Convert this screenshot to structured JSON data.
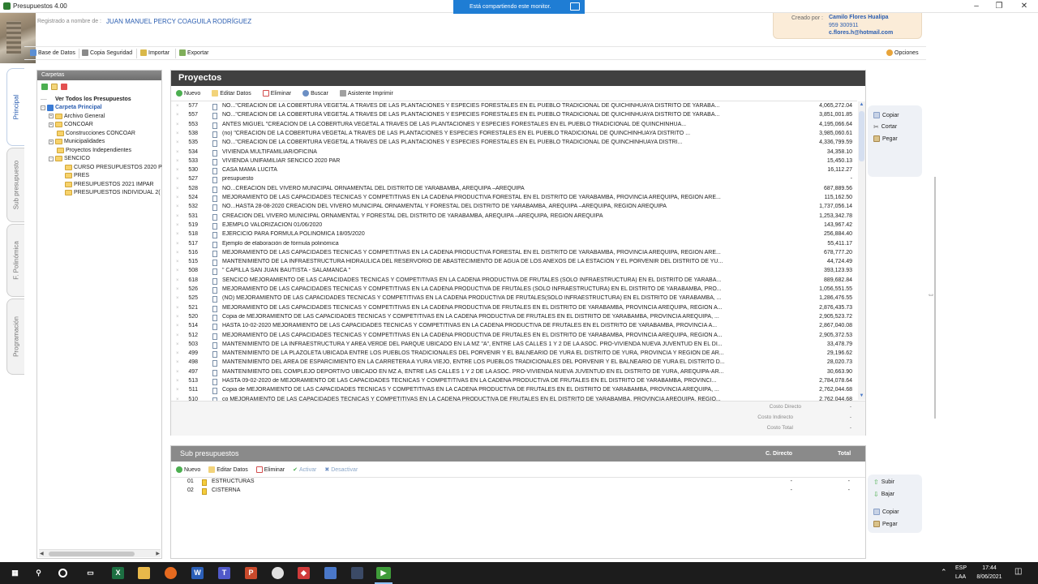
{
  "window": {
    "title": "Presupuestos 4.00",
    "share_banner": "Está compartiendo este monitor."
  },
  "header": {
    "registered_label": "Registrado a nombre de :",
    "registered_name": "JUAN MANUEL PERCY COAGUILA RODRÍGUEZ",
    "creator_label": "Creado por :",
    "creator_name": "Camilo Flores Hualipa",
    "creator_phone": "959 300911",
    "creator_email": "c.flores.h@hotmail.com"
  },
  "toolbar": {
    "database": "Base de Datos",
    "backup": "Copia Seguridad",
    "import": "Importar",
    "export": "Exportar",
    "options": "Opciones"
  },
  "vertical_tabs": [
    "Principal",
    "Sub presupuesto",
    "F. Polinómica",
    "Programación"
  ],
  "folders": {
    "title": "Carpetas",
    "items": [
      {
        "label": "Ver Todos los Presupuestos",
        "bold": true
      },
      {
        "label": "Carpeta Principal"
      },
      {
        "label": "Archivo General"
      },
      {
        "label": "CONCOAR"
      },
      {
        "label": "Construcciones CONCOAR"
      },
      {
        "label": "Municipalidades"
      },
      {
        "label": "Proyectos Independientes"
      },
      {
        "label": "SENCICO"
      },
      {
        "label": "CURSO PRESUPUESTOS 2020 P"
      },
      {
        "label": "PRES"
      },
      {
        "label": "PRESUPUESTOS 2021 IMPAR"
      },
      {
        "label": "PRESUPUESTOS INDIVIDUAL 2("
      }
    ]
  },
  "projects": {
    "title": "Proyectos",
    "tools": {
      "new": "Nuevo",
      "edit": "Editar Datos",
      "delete": "Eliminar",
      "search": "Buscar",
      "print": "Asistente Imprimir"
    },
    "rows": [
      {
        "id": "577",
        "desc": "NO...\"CREACION DE LA COBERTURA VEGETAL A TRAVES DE LAS PLANTACIONES Y ESPECIES FORESTALES  EN EL PUEBLO TRADICIONAL DE QUICHINHUAYA DISTRITO DE YARABA...",
        "amount": "4,065,272.04"
      },
      {
        "id": "557",
        "desc": "NO...\"CREACION DE LA COBERTURA VEGETAL A TRAVES DE LAS PLANTACIONES Y ESPECIES FORESTALES  EN EL PUEBLO TRADICIONAL DE QUICHINHUAYA DISTRITO DE YARABA...",
        "amount": "3,851,001.85"
      },
      {
        "id": "553",
        "desc": "ANTES MIGUEL \"CREACION DE LA COBERTURA VEGETAL A TRAVES DE LAS PLANTACIONES Y ESPECIES FORESTALES EN EL PUEBLO TRADICIONAL DE QUINCHINHUA...",
        "amount": "4,195,066.64"
      },
      {
        "id": "538",
        "desc": "(no) \"CREACION DE LA COBERTURA VEGETAL A TRAVES DE LAS PLANTACIONES Y ESPECIES FORESTALES EN EL PUEBLO TRADICIONAL DE QUINCHINHUAYA DISTRITO ...",
        "amount": "3,985,060.61"
      },
      {
        "id": "535",
        "desc": "NO...\"CREACION DE LA COBERTURA VEGETAL A TRAVES DE LAS PLANTACIONES Y ESPECIES FORESTALES EN EL PUEBLO TRADICIONAL DE QUINCHINHUAYA DISTRI...",
        "amount": "4,336,799.59"
      },
      {
        "id": "534",
        "desc": "VIVIENDA MULTIFAMILIAR/OFICINA",
        "amount": "34,358.10"
      },
      {
        "id": "533",
        "desc": "VIVIENDA UNIFAMILIAR SENCICO 2020 PAR",
        "amount": "15,450.13"
      },
      {
        "id": "530",
        "desc": "CASA MAMÁ LUCITA",
        "amount": "16,112.27"
      },
      {
        "id": "527",
        "desc": "presupuesto",
        "amount": "-"
      },
      {
        "id": "528",
        "desc": "NO...CREACION DEL VIVERO MUNICIPAL ORNAMENTAL DEL DISTRITO DE YARABAMBA, AREQUIPA –AREQUIPA",
        "amount": "687,889.56"
      },
      {
        "id": "524",
        "desc": "MEJORAMIENTO DE LAS CAPACIDADES TÉCNICAS Y COMPETITIVAS EN LA CADENA PRODUCTIVA FORESTAL EN EL DISTRITO DE YARABAMBA, PROVINCIA AREQUIPA, REGIÓN ARE...",
        "amount": "115,162.50"
      },
      {
        "id": "532",
        "desc": "NO...HASTA 28-08-2020 CREACION DEL VIVERO MUNICIPAL ORNAMENTAL Y FORESTAL DEL DISTRITO DE YARABAMBA, AREQUIPA –AREQUIPA, REGIÓN AREQUIPA",
        "amount": "1,737,056.14"
      },
      {
        "id": "531",
        "desc": "CREACION DEL VIVERO MUNICIPAL ORNAMENTAL Y FORESTAL DEL DISTRITO DE YARABAMBA, AREQUIPA –AREQUIPA, REGIÓN AREQUIPA",
        "amount": "1,253,342.78"
      },
      {
        "id": "519",
        "desc": "EJEMPLO VALORIZACIÓN  01/06/2020",
        "amount": "143,967.42"
      },
      {
        "id": "518",
        "desc": "EJERCICIO PARA FÓRMULA POLINÓMICA 18/05/2020",
        "amount": "256,884.40"
      },
      {
        "id": "517",
        "desc": "Ejemplo de elaboración de fórmula polinómica",
        "amount": "55,411.17"
      },
      {
        "id": "516",
        "desc": "MEJORAMIENTO DE LAS CAPACIDADES TÉCNICAS Y COMPETITIVAS EN LA CADENA PRODUCTIVA FORESTAL EN EL DISTRITO DE YARABAMBA, PROVINCIA AREQUIPA, REGIÓN ARE...",
        "amount": "678,777.20"
      },
      {
        "id": "515",
        "desc": "MANTENIMIENTO DE LA INFRAESTRUCTURA HIDRÁULICA DEL  RESERVORIO DE ABASTECIMIENTO DE AGUA DE LOS ANEXOS DE LA ESTACIÓN Y EL PORVENIR DEL DISTRITO DE YU...",
        "amount": "44,724.49"
      },
      {
        "id": "508",
        "desc": "\" CAPILLA SAN JUAN BAUTISTA -  SALAMANCA \"",
        "amount": "393,123.93"
      },
      {
        "id": "618",
        "desc": "SENCICO MEJORAMIENTO DE LAS CAPACIDADES TÉCNICAS Y COMPETITIVAS EN LA CADENA PRODUCTIVA DE FRUTALES (SOLO INFRAESTRUCTURA) EN EL DISTRITO DE YARABA...",
        "amount": "889,682.84"
      },
      {
        "id": "526",
        "desc": "MEJORAMIENTO DE LAS CAPACIDADES TÉCNICAS Y COMPETITIVAS EN LA CADENA PRODUCTIVA DE FRUTALES (SOLO INFRAESTRUCTURA) EN EL DISTRITO DE YARABAMBA, PRO...",
        "amount": "1,056,551.55"
      },
      {
        "id": "525",
        "desc": "(NO) MEJORAMIENTO DE LAS CAPACIDADES TÉCNICAS Y COMPETITIVAS EN LA CADENA PRODUCTIVA DE FRUTALES(SOLO INFRAESTRUCTURA) EN EL DISTRITO DE YARABAMBA, ...",
        "amount": "1,286,476.55"
      },
      {
        "id": "521",
        "desc": "MEJORAMIENTO DE LAS CAPACIDADES TÉCNICAS Y COMPETITIVAS EN LA CADENA PRODUCTIVA DE FRUTALES EN EL DISTRITO DE YARABAMBA, PROVINCIA AREQUIPA, REGIÓN A...",
        "amount": "2,876,435.73"
      },
      {
        "id": "520",
        "desc": "Copia de MEJORAMIENTO DE LAS CAPACIDADES TÉCNICAS Y COMPETITIVAS EN LA CADENA PRODUCTIVA DE FRUTALES EN EL DISTRITO DE YARABAMBA, PROVINCIA AREQUIPA, ...",
        "amount": "2,905,523.72"
      },
      {
        "id": "514",
        "desc": "HASTA 10-02-2020 MEJORAMIENTO DE LAS CAPACIDADES TÉCNICAS Y COMPETITIVAS EN LA CADENA PRODUCTIVA DE FRUTALES EN EL DISTRITO DE YARABAMBA, PROVINCIA A...",
        "amount": "2,867,040.08"
      },
      {
        "id": "512",
        "desc": "MEJORAMIENTO DE LAS CAPACIDADES TÉCNICAS Y COMPETITIVAS EN LA CADENA PRODUCTIVA DE FRUTALES EN EL DISTRITO DE YARABAMBA, PROVINCIA AREQUIPA, REGIÓN A...",
        "amount": "2,905,372.53"
      },
      {
        "id": "503",
        "desc": "MANTENIMIENTO DE LA INFRAESTRUCTURA Y AREA VERDE DEL PARQUE UBICADO EN LA MZ \"A\", ENTRE LAS CALLES 1 Y 2 DE LA ASOC. PRO-VIVIENDA NUEVA JUVENTUD EN EL DI...",
        "amount": "33,478.79"
      },
      {
        "id": "499",
        "desc": "MANTENIMIENTO DE LA PLAZOLETA UBICADA ENTRE LOS PUEBLOS TRADICIONALES DEL PORVENIR Y EL BALNEARIO DE YURA EL DISTRITO DE YURA, PROVINCIA Y REGION DE AR...",
        "amount": "29,196.62"
      },
      {
        "id": "498",
        "desc": "MANTENIMIENTO DEL AREA DE ESPARCIMIENTO EN LA CARRETERA A YURA VIEJO, ENTRE LOS PUEBLOS TRADICIONALES DEL PORVENIR Y EL BALNEARIO DE YURA EL DISTRITO D...",
        "amount": "28,020.73"
      },
      {
        "id": "497",
        "desc": "MANTENIMIENTO DEL COMPLEJO DEPORTIVO UBICADO EN MZ A, ENTRE LAS CALLES 1 Y 2 DE LA ASOC. PRO-VIVIENDA NUEVA JUVENTUD EN EL DISTRITO DE YURA, AREQUIPA-AR...",
        "amount": "30,663.90"
      },
      {
        "id": "513",
        "desc": "HASTA 09-02-2020 de MEJORAMIENTO DE LAS CAPACIDADES TÉCNICAS Y COMPETITIVAS EN LA CADENA PRODUCTIVA DE FRUTALES EN EL DISTRITO DE YARABAMBA, PROVINCI...",
        "amount": "2,784,078.64"
      },
      {
        "id": "511",
        "desc": "Copia de MEJORAMIENTO DE LAS CAPACIDADES TÉCNICAS Y COMPETITIVAS EN LA CADENA PRODUCTIVA DE FRUTALES EN EL DISTRITO DE YARABAMBA, PROVINCIA AREQUIPA, ...",
        "amount": "2,762,044.68"
      },
      {
        "id": "510",
        "desc": "co MEJORAMIENTO DE LAS CAPACIDADES TÉCNICAS Y COMPETITIVAS EN LA CADENA PRODUCTIVA DE FRUTALES EN EL DISTRITO DE YARABAMBA, PROVINCIA AREQUIPA, REGIÓ...",
        "amount": "2,762,044.68"
      }
    ],
    "costs": {
      "direct_label": "Costo Directo",
      "indirect_label": "Costo Indirecto",
      "total_label": "Costo Total",
      "direct": "-",
      "indirect": "-",
      "total": "-"
    }
  },
  "sub_budgets": {
    "title": "Sub presupuestos",
    "col_direct": "C. Directo",
    "col_total": "Total",
    "tools": {
      "new": "Nuevo",
      "edit": "Editar Datos",
      "delete": "Eliminar",
      "activate": "Activar",
      "deactivate": "Desactivar"
    },
    "rows": [
      {
        "code": "01",
        "name": "ESTRUCTURAS",
        "direct": "-",
        "total": "-"
      },
      {
        "code": "02",
        "name": "CISTERNA",
        "direct": "-",
        "total": "-"
      }
    ]
  },
  "side_actions": {
    "copy": "Copiar",
    "cut": "Cortar",
    "paste": "Pegar",
    "up": "Subir",
    "down": "Bajar",
    "copy2": "Copiar",
    "paste2": "Pegar"
  },
  "taskbar": {
    "lang1": "ESP",
    "lang2": "LAA",
    "time": "17:44",
    "date": "8/06/2021"
  },
  "colors": {
    "accent_blue": "#2a5db0",
    "panel_header": "#404040",
    "sub_header": "#8a8a8a",
    "share_banner": "#1f7dd4"
  }
}
